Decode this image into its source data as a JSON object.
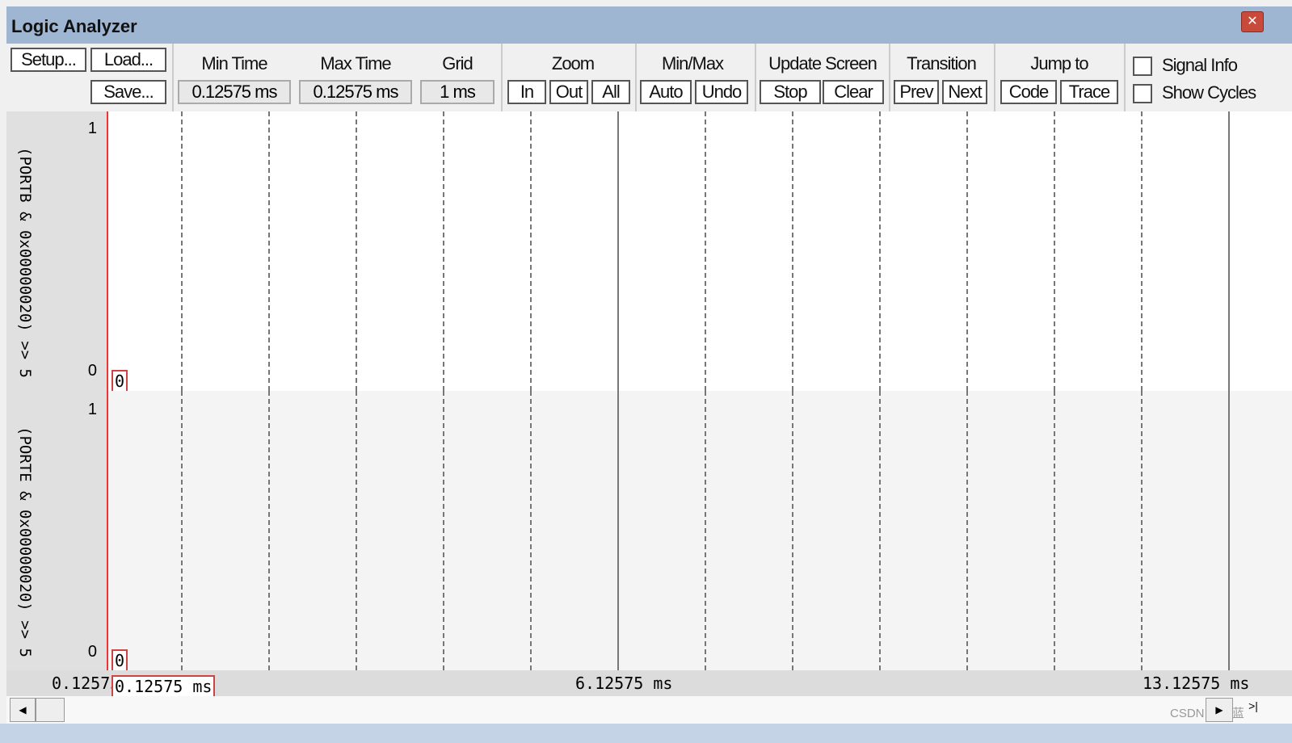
{
  "window": {
    "title": "Logic Analyzer",
    "close_icon": "close-icon"
  },
  "toolbar": {
    "setup": "Setup...",
    "load": "Load...",
    "save": "Save...",
    "min_time_label": "Min Time",
    "min_time": "0.12575 ms",
    "max_time_label": "Max Time",
    "max_time": "0.12575 ms",
    "grid_label": "Grid",
    "grid": "1 ms",
    "zoom_label": "Zoom",
    "zoom_in": "In",
    "zoom_out": "Out",
    "zoom_all": "All",
    "minmax_label": "Min/Max",
    "auto": "Auto",
    "undo": "Undo",
    "update_label": "Update Screen",
    "stop": "Stop",
    "clear": "Clear",
    "transition_label": "Transition",
    "prev": "Prev",
    "next": "Next",
    "jump_label": "Jump to",
    "code": "Code",
    "trace": "Trace",
    "signal_info": "Signal Info",
    "signal_info_checked": false,
    "show_cycles": "Show Cycles",
    "show_cycles_checked": false
  },
  "signals": [
    {
      "name": "(PORTB & 0x00000020) >> 5",
      "max": "1",
      "min": "0",
      "value": "0"
    },
    {
      "name": "(PORTE & 0x00000020) >> 5",
      "max": "1",
      "min": "0",
      "value": "0"
    }
  ],
  "time_axis": {
    "left": "0.12575",
    "cursor": "0.12575 ms",
    "mid": "6.12575 ms",
    "right": "13.12575 ms"
  },
  "watermark": "CSDN @红蓝"
}
